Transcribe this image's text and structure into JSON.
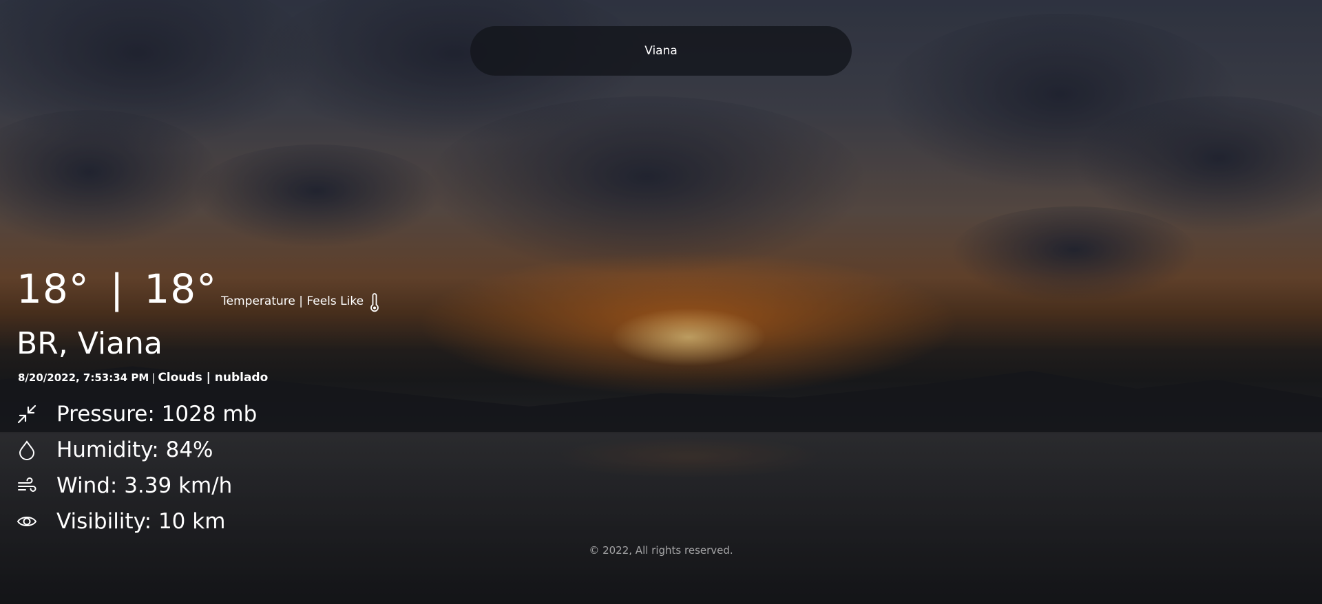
{
  "search": {
    "value": "Viana"
  },
  "weather": {
    "temperature": "18°",
    "separator": "|",
    "feels_like": "18°",
    "caption": "Temperature | Feels Like",
    "location": "BR, Viana",
    "datetime": "8/20/2022, 7:53:34 PM",
    "meta_separator": "|",
    "condition": "Clouds | nublado"
  },
  "stats": {
    "pressure": "Pressure: 1028 mb",
    "humidity": "Humidity: 84%",
    "wind": "Wind: 3.39 km/h",
    "visibility": "Visibility: 10 km"
  },
  "icons": {
    "thermometer": "thermometer-icon",
    "pressure": "compress-arrows-icon",
    "humidity": "droplet-icon",
    "wind": "wind-icon",
    "visibility": "eye-icon"
  },
  "footer": {
    "text": "© 2022, All rights reserved."
  }
}
